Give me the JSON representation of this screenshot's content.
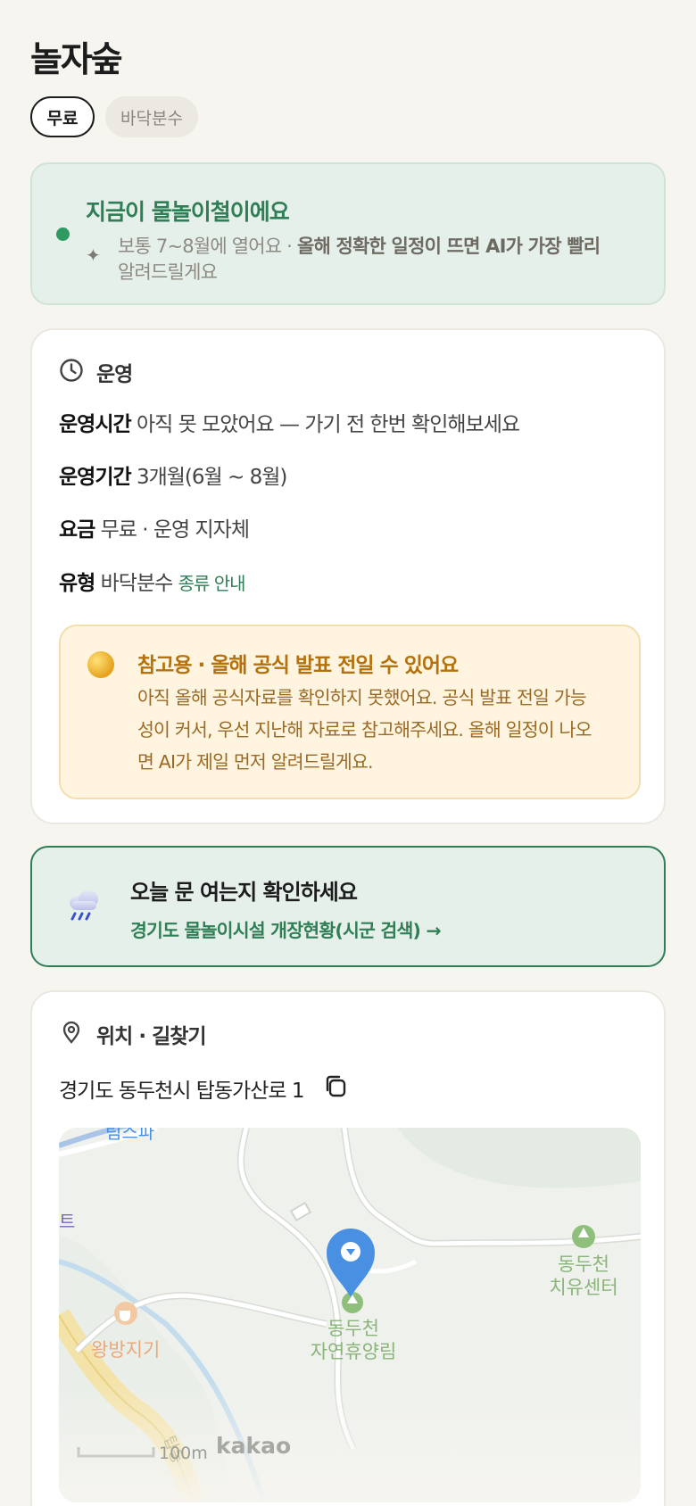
{
  "page": {
    "title": "놀자숲"
  },
  "chips": [
    {
      "label": "무료",
      "active": true
    },
    {
      "label": "바닥분수",
      "active": false
    }
  ],
  "season_notice": {
    "title": "지금이 물놀이철이에요",
    "text_plain": "보통 7~8월에 열어요 · ",
    "text_bold": "올해 정확한 일정이 뜨면 AI가 가장 빨리",
    "text_tail": "알려드릴게요",
    "icon": "sparkle-icon"
  },
  "operation": {
    "header": "운영",
    "icon": "clock-icon",
    "rows": [
      {
        "label": "운영시간",
        "value": "아직 못 모았어요 — 가기 전 한번 확인해보세요"
      },
      {
        "label": "운영기간",
        "value": "3개월(6월 ~ 8월)"
      },
      {
        "label": "요금",
        "value": "무료 · 운영 지자체"
      },
      {
        "label": "유형",
        "value": "바닥분수",
        "link": "종류 안내"
      }
    ],
    "notice": {
      "title": "참고용 · 올해 공식 발표 전일 수 있어요",
      "body": "아직 올해 공식자료를 확인하지 못했어요. 공식 발표 전일 가능성이 커서, 우선 지난해 자료로 참고해주세요. 올해 일정이 나오면 AI가 제일 먼저 알려드릴게요.",
      "icon": "sun-icon"
    }
  },
  "check_card": {
    "title": "오늘 문 여는지 확인하세요",
    "link": "경기도 물놀이시설 개장현황(시군 검색) →",
    "icon": "rain-cloud-icon"
  },
  "location": {
    "header": "위치 · 길찾기",
    "icon": "pin-icon",
    "address": "경기도 동두천시 탑동가산로 1",
    "copy_icon": "copy-icon",
    "map": {
      "labels": {
        "place_main": "동두천\n자연휴양림",
        "place_right": "동두천\n치유센터",
        "place_left": "왕방지기",
        "top_cut": "림스파",
        "left_cut": "트",
        "road_cut": "탑동"
      },
      "scale": "100m",
      "brand": "kakao"
    }
  },
  "colors": {
    "accent_green": "#2f7e55",
    "notice_orange": "#b3720e",
    "marker_blue": "#4a90e2"
  }
}
